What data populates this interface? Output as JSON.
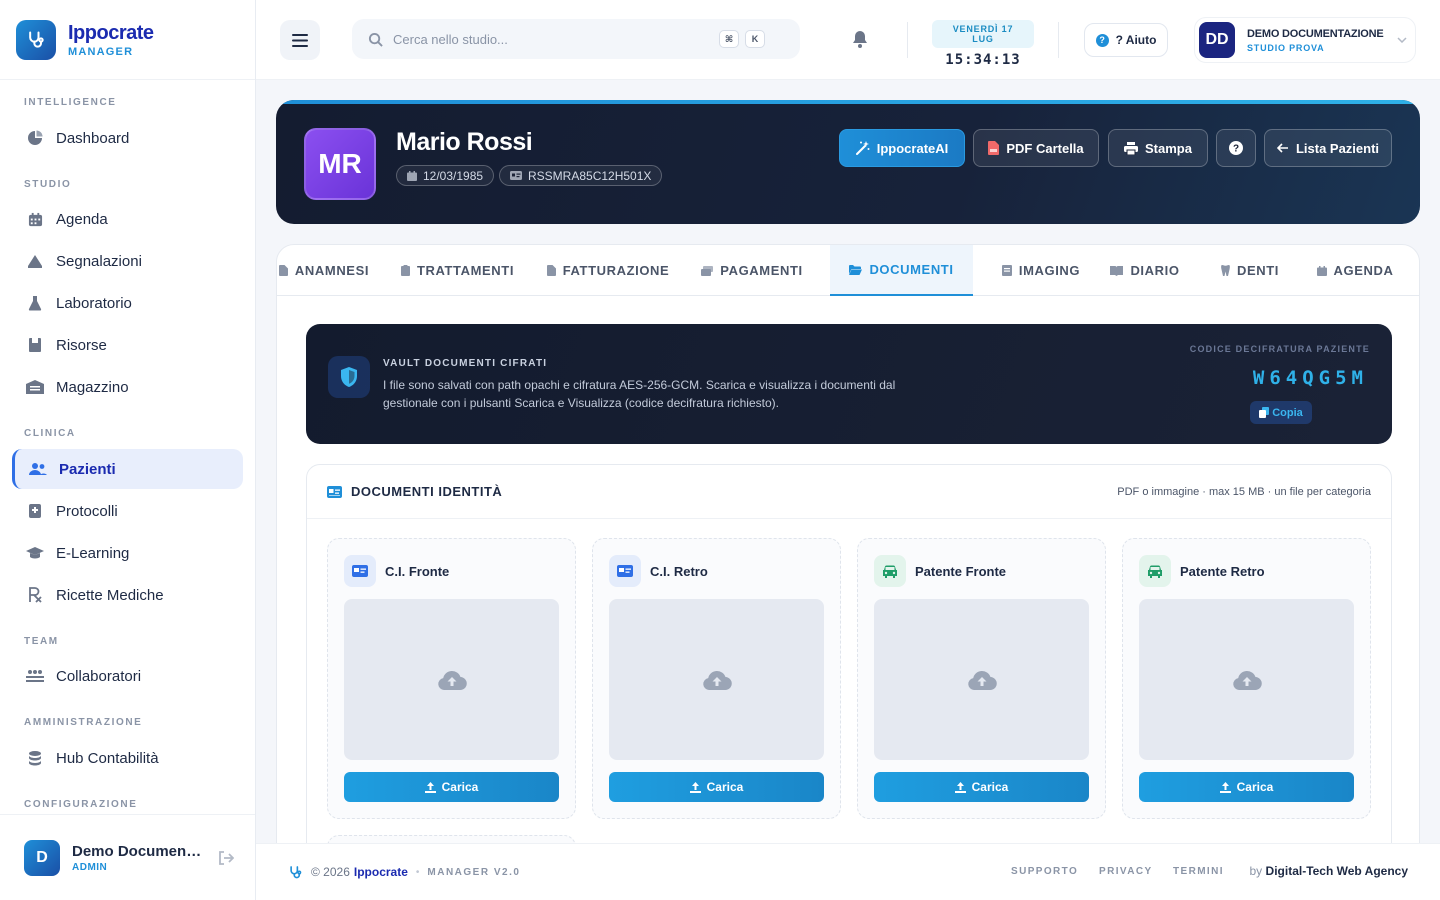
{
  "brand": {
    "name": "Ippocrate",
    "sub": "MANAGER"
  },
  "sidebar": {
    "groups": [
      {
        "label": "INTELLIGENCE"
      },
      {
        "label": "STUDIO"
      },
      {
        "label": "CLINICA"
      },
      {
        "label": "TEAM"
      },
      {
        "label": "AMMINISTRAZIONE"
      },
      {
        "label": "CONFIGURAZIONE"
      }
    ],
    "items": [
      {
        "label": "Dashboard",
        "icon": "pie-chart-icon"
      },
      {
        "label": "Agenda",
        "icon": "calendar-icon"
      },
      {
        "label": "Segnalazioni",
        "icon": "alert-icon"
      },
      {
        "label": "Laboratorio",
        "icon": "flask-icon"
      },
      {
        "label": "Risorse",
        "icon": "resources-icon"
      },
      {
        "label": "Magazzino",
        "icon": "warehouse-icon"
      },
      {
        "label": "Pazienti",
        "icon": "users-icon",
        "active": true
      },
      {
        "label": "Protocolli",
        "icon": "protocol-icon"
      },
      {
        "label": "E-Learning",
        "icon": "graduation-cap-icon"
      },
      {
        "label": "Ricette Mediche",
        "icon": "prescription-icon"
      },
      {
        "label": "Collaboratori",
        "icon": "team-icon"
      },
      {
        "label": "Hub Contabilità",
        "icon": "coins-icon"
      }
    ],
    "user": {
      "initial": "D",
      "name": "Demo Documentazione",
      "role": "ADMIN"
    }
  },
  "topbar": {
    "search_placeholder": "Cerca nello studio...",
    "kbd": [
      "⌘",
      "K"
    ],
    "date": "VENERDÌ 17 LUG",
    "time": "15:34:13",
    "help_label": "? Aiuto",
    "user": {
      "initials": "DD",
      "name": "DEMO DOCUMENTAZIONE",
      "studio": "STUDIO PROVA"
    }
  },
  "patient": {
    "initials": "MR",
    "name": "Mario Rossi",
    "birthdate": "12/03/1985",
    "fiscal_code": "RSSMRA85C12H501X",
    "buttons": {
      "ai": "IppocrateAI",
      "pdf": "PDF Cartella",
      "print": "Stampa",
      "list": "Lista Pazienti"
    }
  },
  "tabs": [
    {
      "label": "ANAMNESI"
    },
    {
      "label": "TRATTAMENTI"
    },
    {
      "label": "FATTURAZIONE"
    },
    {
      "label": "PAGAMENTI"
    },
    {
      "label": "DOCUMENTI",
      "active": true
    },
    {
      "label": "IMAGING"
    },
    {
      "label": "DIARIO"
    },
    {
      "label": "DENTI"
    },
    {
      "label": "AGENDA"
    }
  ],
  "vault": {
    "title": "VAULT DOCUMENTI CIFRATI",
    "description": "I file sono salvati con path opachi e cifratura AES-256-GCM. Scarica e visualizza i documenti dal gestionale con i pulsanti Scarica e Visualizza (codice decifratura richiesto).",
    "code_label": "CODICE DECIFRATURA PAZIENTE",
    "code": "W64QG5M",
    "copy_label": "Copia"
  },
  "docs": {
    "title": "DOCUMENTI IDENTITÀ",
    "note": "PDF o immagine · max 15 MB · un file per categoria",
    "cards": [
      {
        "title": "C.I. Fronte",
        "icon": "id-card-icon",
        "upload": "Carica"
      },
      {
        "title": "C.I. Retro",
        "icon": "id-card-icon",
        "upload": "Carica"
      },
      {
        "title": "Patente Fronte",
        "icon": "car-icon",
        "upload": "Carica"
      },
      {
        "title": "Patente Retro",
        "icon": "car-icon",
        "upload": "Carica"
      }
    ]
  },
  "footer": {
    "copy": "© 2026",
    "brand": "Ippocrate",
    "version": "MANAGER V2.0",
    "links": [
      "SUPPORTO",
      "PRIVACY",
      "TERMINI"
    ],
    "by_prefix": "by",
    "by_name": "Digital-Tech Web Agency"
  }
}
